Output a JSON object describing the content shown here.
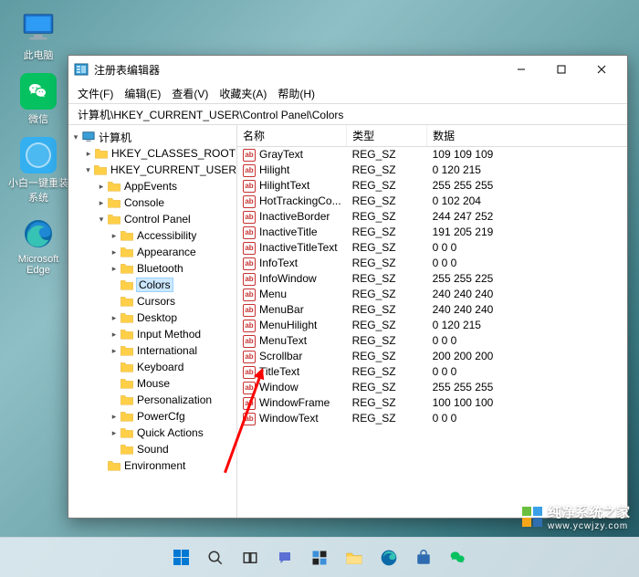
{
  "desktop": {
    "icons": [
      {
        "id": "this-pc",
        "label": "此电脑"
      },
      {
        "id": "wechat",
        "label": "微信"
      },
      {
        "id": "xiaobai",
        "label": "小白一键重装系统"
      },
      {
        "id": "edge",
        "label": "Microsoft Edge"
      }
    ]
  },
  "window": {
    "title": "注册表编辑器",
    "menu": [
      "文件(F)",
      "编辑(E)",
      "查看(V)",
      "收藏夹(A)",
      "帮助(H)"
    ],
    "path": "计算机\\HKEY_CURRENT_USER\\Control Panel\\Colors",
    "tree": {
      "root": "计算机",
      "hives": [
        {
          "label": "HKEY_CLASSES_ROOT",
          "expanded": false
        },
        {
          "label": "HKEY_CURRENT_USER",
          "expanded": true,
          "children": [
            {
              "label": "AppEvents",
              "expandable": true
            },
            {
              "label": "Console",
              "expandable": true
            },
            {
              "label": "Control Panel",
              "expandable": true,
              "expanded": true,
              "children": [
                {
                  "label": "Accessibility",
                  "expandable": true
                },
                {
                  "label": "Appearance",
                  "expandable": true
                },
                {
                  "label": "Bluetooth",
                  "expandable": true
                },
                {
                  "label": "Colors",
                  "selected": true
                },
                {
                  "label": "Cursors"
                },
                {
                  "label": "Desktop",
                  "expandable": true
                },
                {
                  "label": "Input Method",
                  "expandable": true
                },
                {
                  "label": "International",
                  "expandable": true
                },
                {
                  "label": "Keyboard"
                },
                {
                  "label": "Mouse"
                },
                {
                  "label": "Personalization"
                },
                {
                  "label": "PowerCfg",
                  "expandable": true
                },
                {
                  "label": "Quick Actions",
                  "expandable": true
                },
                {
                  "label": "Sound"
                }
              ]
            },
            {
              "label": "Environment"
            }
          ]
        }
      ]
    },
    "columns": {
      "name": "名称",
      "type": "类型",
      "data": "数据"
    },
    "values": [
      {
        "name": "GrayText",
        "type": "REG_SZ",
        "data": "109 109 109"
      },
      {
        "name": "Hilight",
        "type": "REG_SZ",
        "data": "0 120 215"
      },
      {
        "name": "HilightText",
        "type": "REG_SZ",
        "data": "255 255 255"
      },
      {
        "name": "HotTrackingCo...",
        "type": "REG_SZ",
        "data": "0 102 204"
      },
      {
        "name": "InactiveBorder",
        "type": "REG_SZ",
        "data": "244 247 252"
      },
      {
        "name": "InactiveTitle",
        "type": "REG_SZ",
        "data": "191 205 219"
      },
      {
        "name": "InactiveTitleText",
        "type": "REG_SZ",
        "data": "0 0 0"
      },
      {
        "name": "InfoText",
        "type": "REG_SZ",
        "data": "0 0 0"
      },
      {
        "name": "InfoWindow",
        "type": "REG_SZ",
        "data": "255 255 225"
      },
      {
        "name": "Menu",
        "type": "REG_SZ",
        "data": "240 240 240"
      },
      {
        "name": "MenuBar",
        "type": "REG_SZ",
        "data": "240 240 240"
      },
      {
        "name": "MenuHilight",
        "type": "REG_SZ",
        "data": "0 120 215"
      },
      {
        "name": "MenuText",
        "type": "REG_SZ",
        "data": "0 0 0"
      },
      {
        "name": "Scrollbar",
        "type": "REG_SZ",
        "data": "200 200 200"
      },
      {
        "name": "TitleText",
        "type": "REG_SZ",
        "data": "0 0 0"
      },
      {
        "name": "Window",
        "type": "REG_SZ",
        "data": "255 255 255"
      },
      {
        "name": "WindowFrame",
        "type": "REG_SZ",
        "data": "100 100 100"
      },
      {
        "name": "WindowText",
        "type": "REG_SZ",
        "data": "0 0 0"
      }
    ]
  },
  "watermark": {
    "title": "纯净系统之家",
    "url": "www.ycwjzy.com"
  },
  "taskbar_icons": [
    "start",
    "search",
    "task-view",
    "chat",
    "widgets",
    "explorer",
    "edge",
    "store",
    "wechat"
  ]
}
